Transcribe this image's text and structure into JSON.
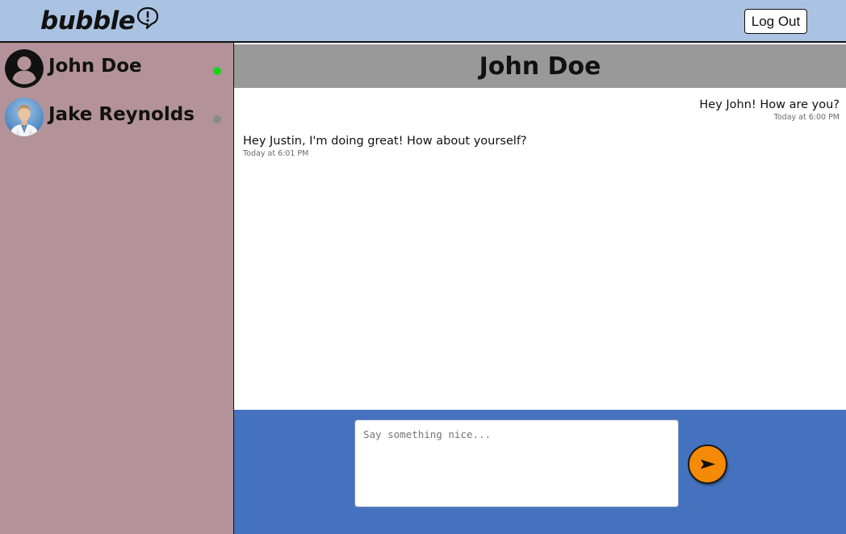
{
  "app": {
    "logo_text": "bubble",
    "logout_label": "Log Out"
  },
  "contacts": [
    {
      "name": "John Doe",
      "status": "online",
      "status_color": "#19d319",
      "avatar": "default-user-icon"
    },
    {
      "name": "Jake Reynolds",
      "status": "offline",
      "status_color": "#8a8a8a",
      "avatar": "photo"
    }
  ],
  "chat": {
    "title": "John Doe",
    "messages": [
      {
        "side": "right",
        "text": "Hey John! How are you?",
        "time": "Today at 6:00 PM"
      },
      {
        "side": "left",
        "text": "Hey Justin, I'm doing great! How about yourself?",
        "time": "Today at 6:01 PM"
      }
    ]
  },
  "composer": {
    "placeholder": "Say something nice...",
    "value": ""
  },
  "colors": {
    "topbar": "#abc3e2",
    "sidebar": "#b39399",
    "chat_header": "#999999",
    "composer": "#4572be",
    "send_button": "#f58a06"
  }
}
